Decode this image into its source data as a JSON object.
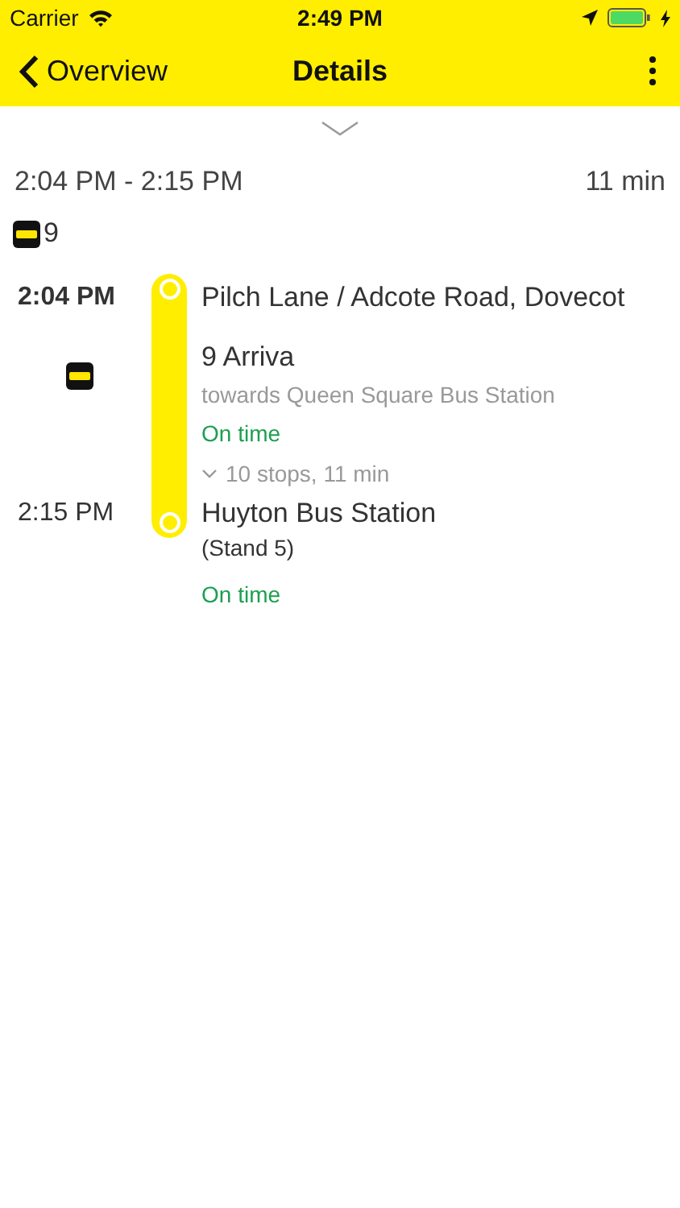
{
  "status_bar": {
    "carrier": "Carrier",
    "time": "2:49 PM"
  },
  "nav": {
    "back": "Overview",
    "title": "Details"
  },
  "summary": {
    "time_range": "2:04 PM - 2:15 PM",
    "duration": "11 min",
    "line": "9"
  },
  "leg": {
    "departure_time": "2:04 PM",
    "departure_stop": "Pilch Lane / Adcote Road, Dovecot",
    "route": "9 Arriva",
    "towards": "towards Queen Square Bus Station",
    "departure_status": "On time",
    "stops": "10 stops, 11 min",
    "arrival_time": "2:15 PM",
    "arrival_stop": "Huyton Bus Station",
    "arrival_detail": "(Stand 5)",
    "arrival_status": "On time"
  }
}
